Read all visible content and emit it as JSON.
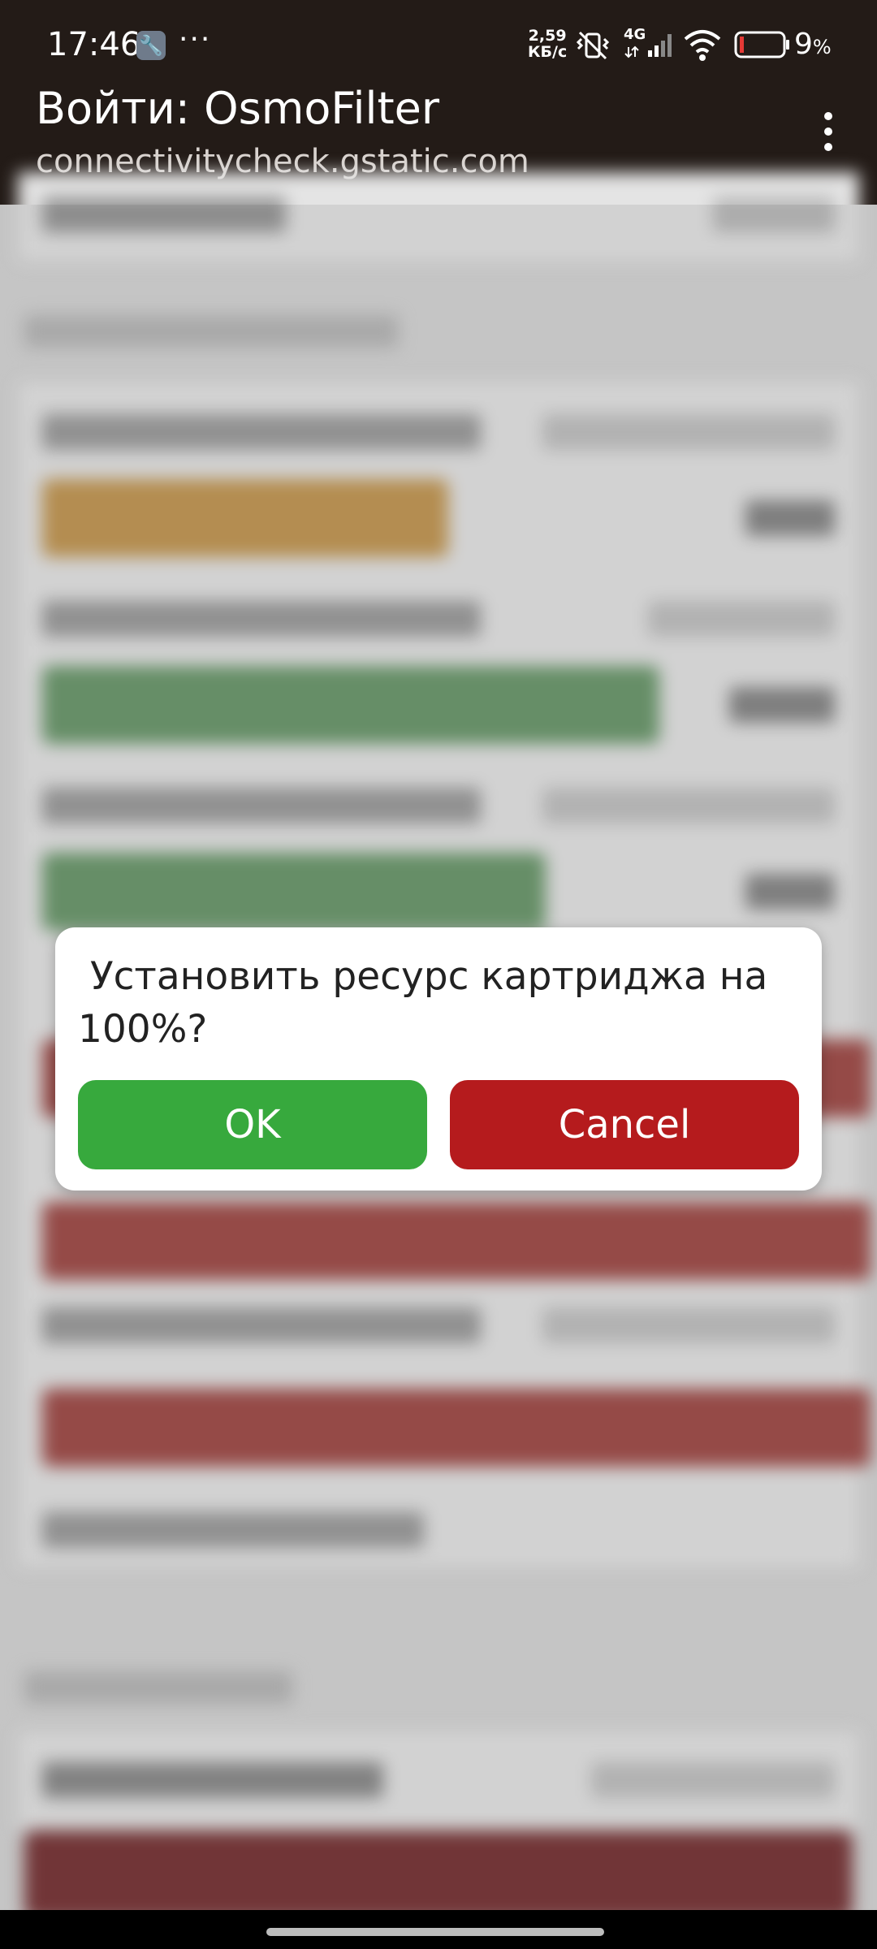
{
  "status_bar": {
    "time": "17:46",
    "notification_icon": "wrench-icon",
    "more_dots": "···",
    "speed_value": "2,59",
    "speed_unit": "КБ/с",
    "network_label": "4G",
    "battery_percent": "9",
    "battery_unit": "%"
  },
  "app_bar": {
    "title": "Войти: OsmoFilter",
    "url": "connectivitycheck.gstatic.com"
  },
  "dialog": {
    "message": " Установить ресурс картриджа на 100%?",
    "ok_label": "OK",
    "cancel_label": "Cancel"
  },
  "colors": {
    "bar_dark": "#231b17",
    "ok_green": "#37a93d",
    "cancel_red": "#b51b1d",
    "bg_orange": "#c49a58",
    "bg_green": "#6f9b70",
    "bg_red": "#a2514e"
  }
}
